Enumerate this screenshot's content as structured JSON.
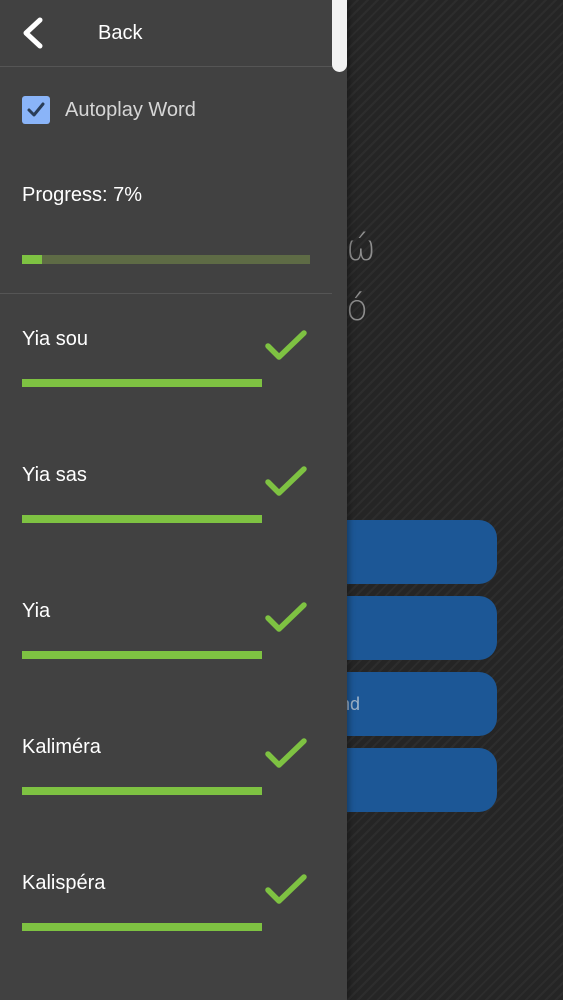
{
  "background": {
    "words": [
      "ώ",
      "ό"
    ],
    "buttons": [
      {
        "label": ""
      },
      {
        "label": ""
      },
      {
        "label": "nd"
      },
      {
        "label": ""
      }
    ]
  },
  "drawer": {
    "back_label": "Back",
    "autoplay": {
      "label": "Autoplay Word",
      "checked": true
    },
    "progress": {
      "label": "Progress: 7%",
      "value": 0.07
    },
    "words": [
      {
        "label": "Yia sou",
        "completed": true,
        "progress": 1.0
      },
      {
        "label": "Yia sas",
        "completed": true,
        "progress": 1.0
      },
      {
        "label": "Yia",
        "completed": true,
        "progress": 1.0
      },
      {
        "label": "Kaliméra",
        "completed": true,
        "progress": 1.0
      },
      {
        "label": "Kalispéra",
        "completed": true,
        "progress": 1.0
      }
    ]
  },
  "colors": {
    "accent_green": "#7ec242",
    "checkbox_blue": "#8ab4f8",
    "button_blue": "#1c5796",
    "drawer_bg": "#414141"
  }
}
